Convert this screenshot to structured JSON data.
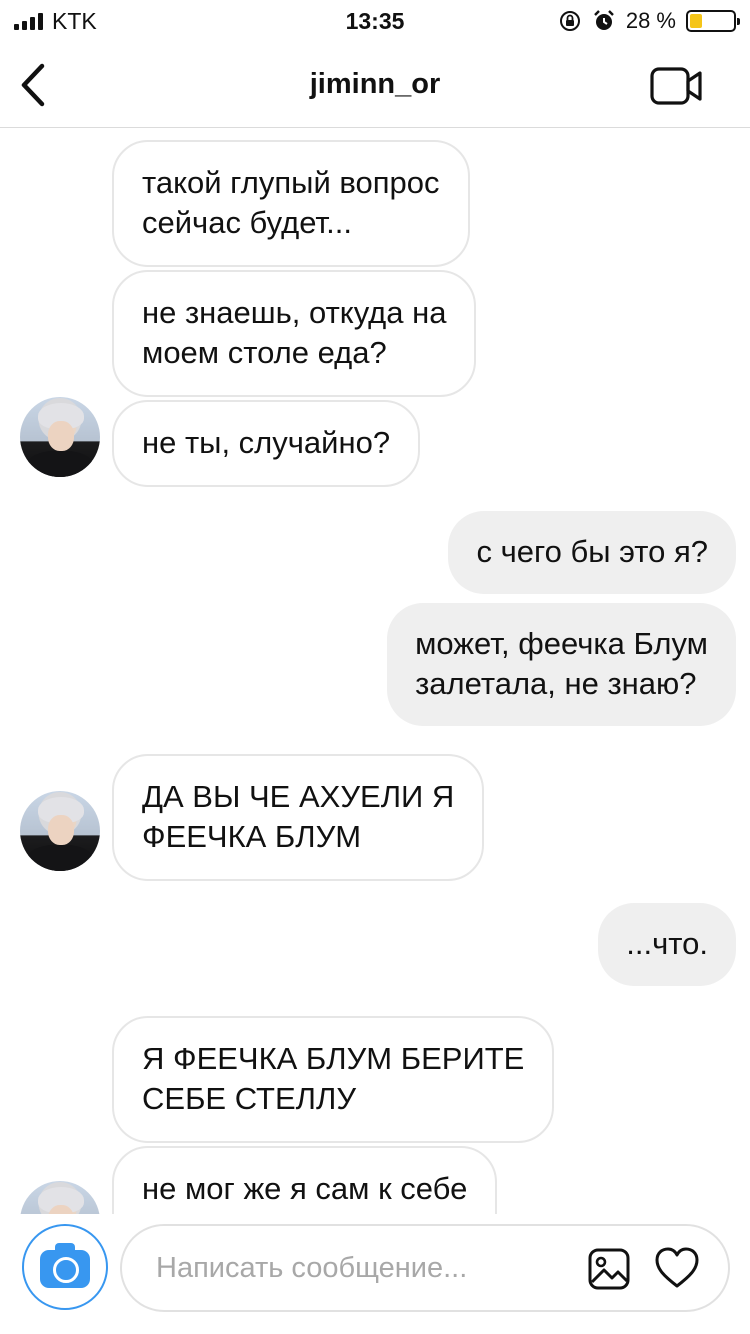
{
  "status": {
    "carrier": "KTK",
    "time": "13:35",
    "battery": "28 %",
    "battery_level": 0.28
  },
  "header": {
    "username": "jiminn_or"
  },
  "messages": [
    {
      "side": "in",
      "text": "такой глупый вопрос\nсейчас будет..."
    },
    {
      "side": "in",
      "text": "не знаешь, откуда на\nмоем столе еда?"
    },
    {
      "side": "in",
      "text": "не ты, случайно?",
      "avatar": true
    },
    {
      "side": "out",
      "text": "с чего бы это я?"
    },
    {
      "side": "out",
      "text": "может, феечка Блум\nзалетала, не знаю?"
    },
    {
      "side": "in",
      "text": "ДА ВЫ ЧЕ АХУЕЛИ Я\nФЕЕЧКА БЛУМ",
      "avatar": true
    },
    {
      "side": "out",
      "text": "...что."
    },
    {
      "side": "in",
      "text": "Я ФЕЕЧКА БЛУМ БЕРИТЕ\nСЕБЕ СТЕЛЛУ"
    },
    {
      "side": "in",
      "text": "не мог же я сам к себе\n...",
      "avatar": true
    }
  ],
  "composer": {
    "placeholder": "Написать сообщение..."
  },
  "icons": {
    "back": "chevron-left-icon",
    "video": "video-camera-icon",
    "camera": "camera-icon",
    "gallery": "image-icon",
    "like": "heart-icon"
  },
  "colors": {
    "accent": "#3897f0",
    "outgoing_bubble": "#efefef",
    "incoming_border": "#e6e6e6",
    "battery": "#f5c518"
  }
}
